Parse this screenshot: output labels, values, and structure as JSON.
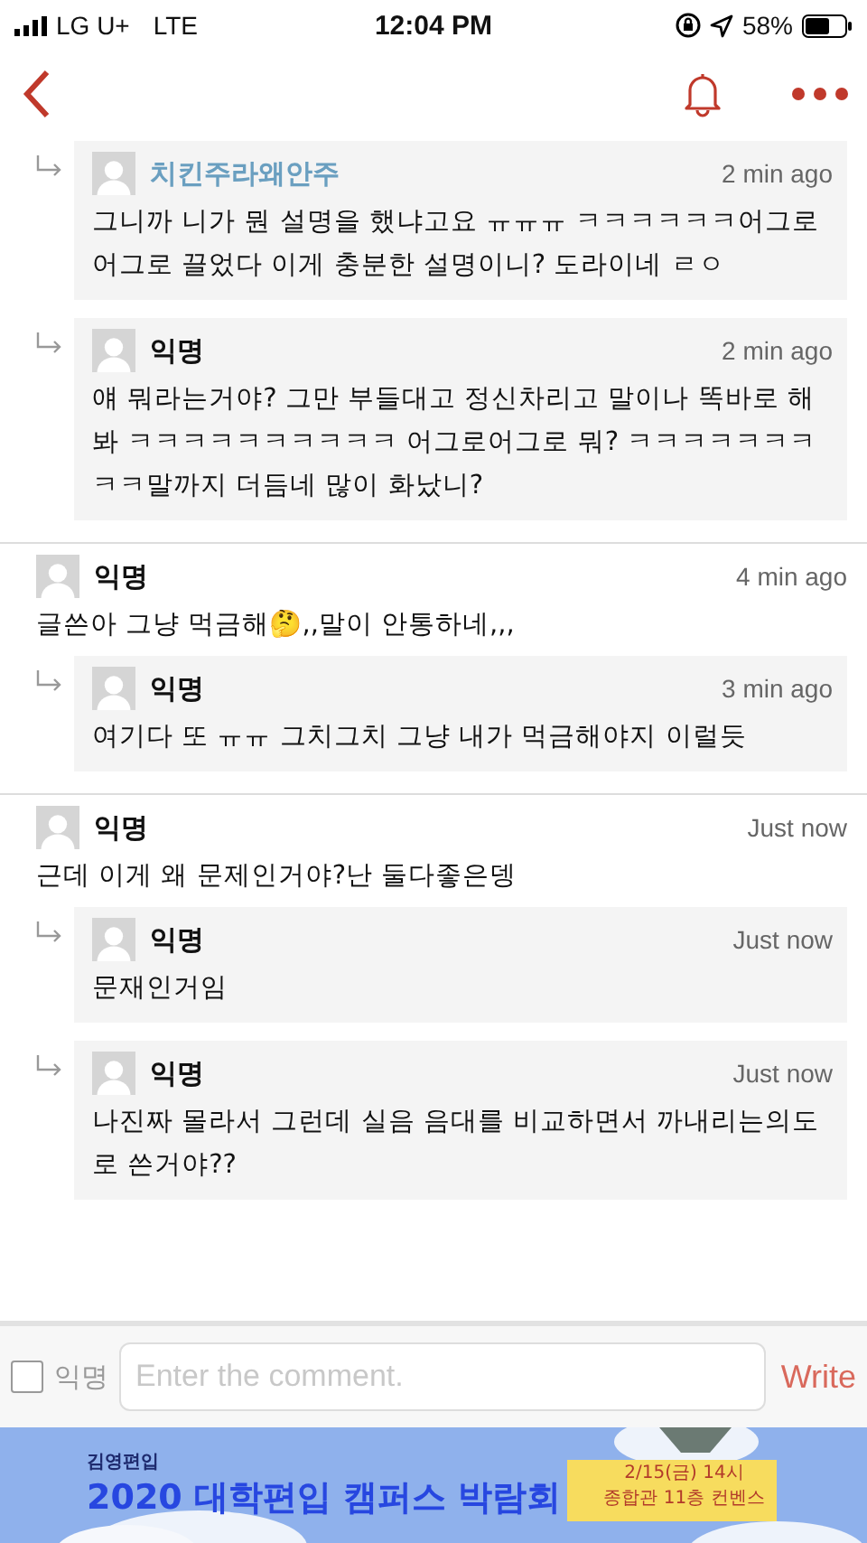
{
  "status_bar": {
    "carrier": "LG U+",
    "network": "LTE",
    "time": "12:04 PM",
    "battery": "58%"
  },
  "comments": [
    {
      "kind": "reply",
      "name": "치킨주라왜안주",
      "author": true,
      "time": "2 min ago",
      "text": "그니까 니가 뭔 설명을 했냐고요 ㅠㅠㅠ ㅋㅋㅋㅋㅋㅋ어그로어그로 끌었다 이게 충분한 설명이니? 도라이네 ㄹㅇ"
    },
    {
      "kind": "reply",
      "name": "익명",
      "author": false,
      "time": "2 min ago",
      "text": "얘 뭐라는거야? 그만 부들대고 정신차리고 말이나 똑바로 해봐 ㅋㅋㅋㅋㅋㅋㅋㅋㅋㅋ 어그로어그로 뭐? ㅋㅋㅋㅋㅋㅋㅋㅋㅋ말까지 더듬네 많이 화났니?"
    },
    {
      "kind": "comment",
      "name": "익명",
      "author": false,
      "time": "4 min ago",
      "text": "글쓴아 그냥 먹금해🤔,,말이 안통하네,,,"
    },
    {
      "kind": "reply",
      "name": "익명",
      "author": false,
      "time": "3 min ago",
      "text": "여기다 또 ㅠㅠ 그치그치 그냥 내가 먹금해야지 이럴듯"
    },
    {
      "kind": "comment",
      "name": "익명",
      "author": false,
      "time": "Just now",
      "text": "근데 이게 왜 문제인거야?난 둘다좋은뎅"
    },
    {
      "kind": "reply",
      "name": "익명",
      "author": false,
      "time": "Just now",
      "text": "문재인거임"
    },
    {
      "kind": "reply",
      "name": "익명",
      "author": false,
      "time": "Just now",
      "text": "나진짜 몰라서 그런데 실음 음대를 비교하면서 까내리는의도로 쓴거야??"
    }
  ],
  "composer": {
    "anonymous_label": "익명",
    "anonymous_checked": false,
    "placeholder": "Enter the comment.",
    "submit": "Write"
  },
  "banner": {
    "brand": "김영편입",
    "headline": "2020 대학편입 캠퍼스 박람회",
    "note_lines": [
      "2/15(금) 14시",
      "종합관 11층 컨벤스"
    ]
  }
}
